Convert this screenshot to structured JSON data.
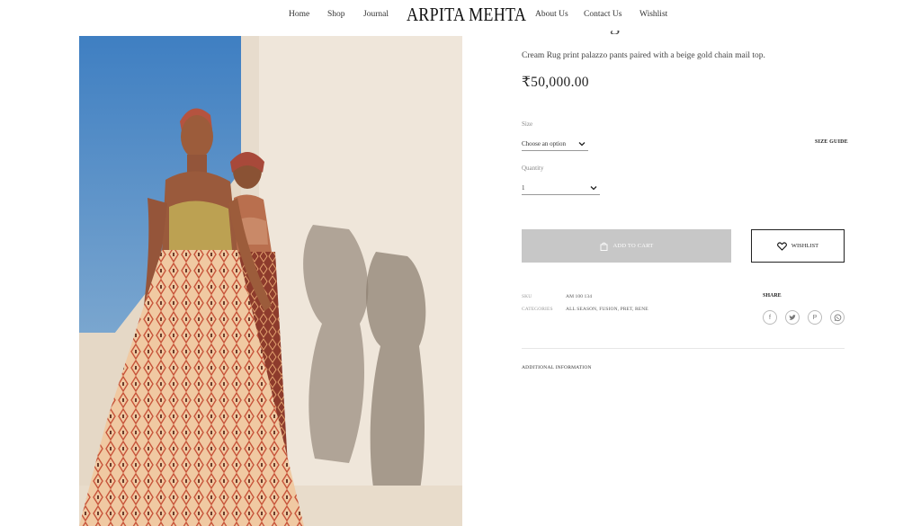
{
  "header": {
    "nav_left": [
      "Home",
      "Shop",
      "Journal"
    ],
    "logo": "ARPITA MEHTA",
    "nav_right": [
      "About Us",
      "Contact Us",
      "Wishlist"
    ]
  },
  "product": {
    "description": "Cream Rug print palazzo pants paired with a beige gold chain mail top.",
    "price": "₹50,000.00",
    "size_label": "Size",
    "size_selected": "Choose an option",
    "size_guide": "SIZE GUIDE",
    "quantity_label": "Quantity",
    "quantity_selected": "1",
    "add_to_cart": "ADD TO CART",
    "wishlist": "WISHLIST",
    "sku_label": "SKU",
    "sku_value": "AM 100 134",
    "categories_label": "CATEGORIES",
    "categories_value": "ALL SEASON, FUSION, PRET, RENE",
    "share_label": "SHARE",
    "social_icons": [
      "facebook-icon",
      "twitter-icon",
      "pinterest-icon",
      "whatsapp-icon"
    ],
    "additional_info": "ADDITIONAL INFORMATION"
  },
  "colors": {
    "cart_button_bg": "#c7c7c7",
    "text_dark": "#222222",
    "sky": "#4f8ac4",
    "wall": "#eae0d3"
  }
}
